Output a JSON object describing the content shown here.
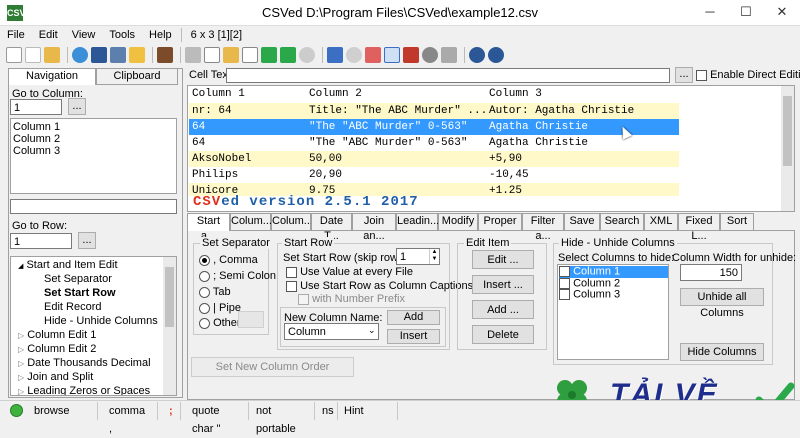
{
  "window": {
    "title": "CSVed D:\\Program Files\\CSVed\\example12.csv",
    "app_icon": "CSV",
    "minimize": "─",
    "maximize": "☐",
    "close": "✕"
  },
  "menu": [
    "File",
    "Edit",
    "View",
    "Tools",
    "Help"
  ],
  "menu_info": "6 x 3 [1][2]",
  "cell_text": {
    "label": "Cell Text:",
    "value": "",
    "ellipsis": "...",
    "direct_editing": "Enable Direct Editing"
  },
  "navigation": {
    "tabs": [
      "Navigation",
      "Clipboard"
    ],
    "go_to_column_label": "Go to Column:",
    "go_to_column_value": "1",
    "browse_btn": "...",
    "columns": [
      "Column 1",
      "Column 2",
      "Column 3"
    ],
    "go_to_row_label": "Go to Row:",
    "go_to_row_value": "1",
    "tree": [
      {
        "label": "Start and Item Edit",
        "level": 0,
        "expander": "◢"
      },
      {
        "label": "Set Separator",
        "level": 1
      },
      {
        "label": "Set Start Row",
        "level": 1,
        "bold": true
      },
      {
        "label": "Edit Record",
        "level": 1
      },
      {
        "label": "Hide - Unhide Columns",
        "level": 1
      },
      {
        "label": "Column Edit 1",
        "level": 0,
        "expander": "▷"
      },
      {
        "label": "Column Edit 2",
        "level": 0,
        "expander": "▷"
      },
      {
        "label": "Date Thousands Decimal",
        "level": 0,
        "expander": "▷"
      },
      {
        "label": "Join and Split",
        "level": 0,
        "expander": "▷"
      },
      {
        "label": "Leading Zeros or Spaces",
        "level": 0,
        "expander": "▷"
      }
    ]
  },
  "grid": {
    "headers": [
      "Column 1",
      "Column 2",
      "Column 3"
    ],
    "rows": [
      {
        "cells": [
          "nr: 64",
          "Title: \"The ABC Murder\" ...",
          "Autor: Agatha Christie"
        ],
        "style": "start"
      },
      {
        "cells": [
          "64",
          "\"The \"ABC Murder\" 0-563\"",
          "Agatha Christie"
        ],
        "style": "selected"
      },
      {
        "cells": [
          "64",
          "\"The \"ABC Murder\" 0-563\"",
          "Agatha Christie"
        ],
        "style": "white"
      },
      {
        "cells": [
          "AksoNobel",
          "50,00",
          "+5,90"
        ],
        "style": "yellow"
      },
      {
        "cells": [
          "Philips",
          "20,90",
          "-10,45"
        ],
        "style": "white"
      },
      {
        "cells": [
          "Unicore",
          "9.75",
          "+1.25"
        ],
        "style": "yellow"
      }
    ],
    "version_banner": "CSVed version 2.5.1 2017",
    "version_accent": "CSV"
  },
  "bottom_tabs": [
    "Start a...",
    "Colum...",
    "Colum...",
    "Date T...",
    "Join an...",
    "Leadin...",
    "Modify",
    "Proper ...",
    "Filter a...",
    "Save",
    "Search ...",
    "XML",
    "Fixed L...",
    "Sort"
  ],
  "separator": {
    "title": "Set Separator",
    "options": [
      {
        "label": ", Comma",
        "selected": true
      },
      {
        "label": "; Semi Colon",
        "selected": false
      },
      {
        "label": "Tab",
        "selected": false
      },
      {
        "label": "| Pipe",
        "selected": false
      },
      {
        "label": "Other",
        "selected": false
      }
    ]
  },
  "start_row": {
    "title": "Start Row",
    "skip_label": "Set Start Row (skip rows):",
    "skip_value": "1",
    "use_value": "Use Value at every File",
    "use_captions": "Use Start Row as Column Captions",
    "with_number_prefix": "with Number Prefix",
    "new_column_label": "New Column Name:",
    "new_column_value": "Column",
    "add_btn": "Add",
    "insert_btn": "Insert"
  },
  "edit_item": {
    "title": "Edit Item",
    "buttons": [
      "Edit ...",
      "Insert ...",
      "Add ...",
      "Delete"
    ]
  },
  "hide_unhide": {
    "title": "Hide - Unhide Columns",
    "select_label": "Select Columns to hide:",
    "columns": [
      "Column 1",
      "Column 2",
      "Column 3"
    ],
    "width_label": "Column Width for unhide:",
    "width_value": "150",
    "unhide_all": "Unhide all Columns",
    "hide_columns": "Hide Columns"
  },
  "new_column_order": "Set New Column Order",
  "status": [
    "browse",
    "comma ,",
    ";",
    "quote char \"",
    "not portable",
    "ns",
    "Hint"
  ],
  "watermark": "TẢI VỀ",
  "colors": {
    "selected": "#3399ff",
    "yellow": "#fff8c8",
    "banner": "#1f5fa8",
    "accent": "#e0301e"
  }
}
